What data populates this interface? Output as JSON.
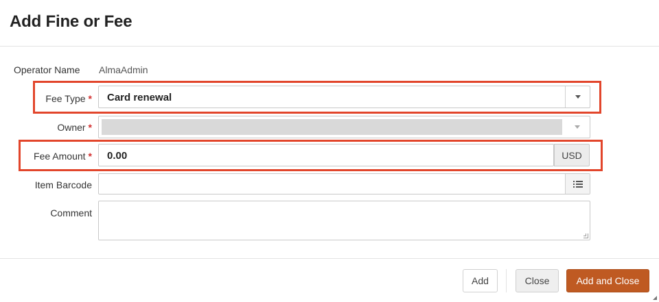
{
  "dialog": {
    "title": "Add Fine or Fee"
  },
  "form": {
    "operator": {
      "label": "Operator Name",
      "value": "AlmaAdmin"
    },
    "fee_type": {
      "label": "Fee Type",
      "required": "*",
      "value": "Card renewal"
    },
    "owner": {
      "label": "Owner",
      "required": "*",
      "value": ""
    },
    "fee_amount": {
      "label": "Fee Amount",
      "required": "*",
      "value": "0.00",
      "currency": "USD"
    },
    "item_barcode": {
      "label": "Item Barcode",
      "value": ""
    },
    "comment": {
      "label": "Comment",
      "value": ""
    }
  },
  "footer": {
    "add_label": "Add",
    "close_label": "Close",
    "add_and_close_label": "Add and Close"
  },
  "colors": {
    "highlight": "#e2452b",
    "primary_button": "#bf5a22",
    "required_asterisk": "#d32f2f"
  },
  "icons": {
    "dropdown": "chevron-down-icon",
    "list": "list-icon",
    "resize": "resize-grip-icon"
  }
}
